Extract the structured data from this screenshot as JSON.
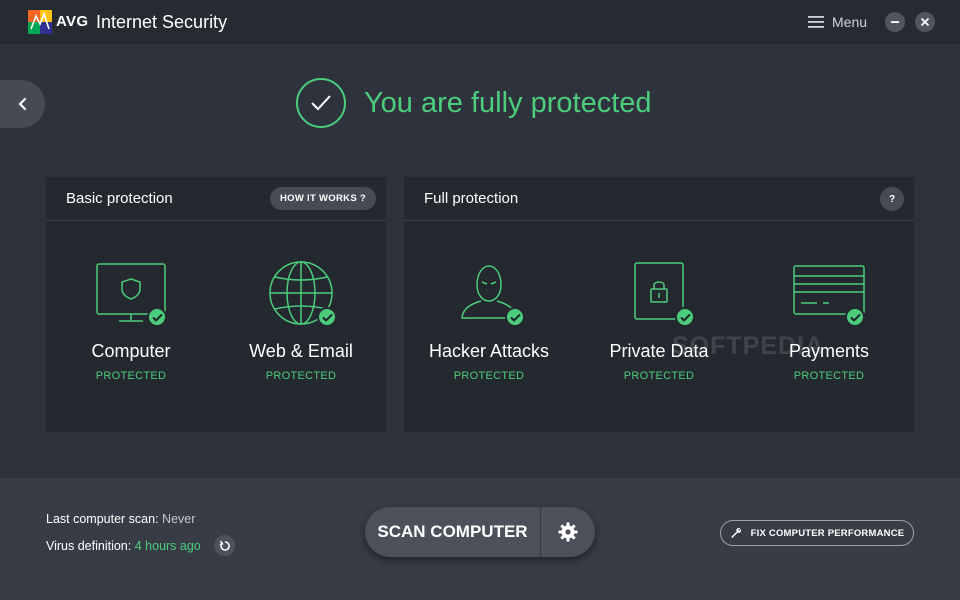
{
  "titlebar": {
    "brand": "AVG",
    "product": "Internet Security",
    "menu_label": "Menu"
  },
  "hero": {
    "status_text": "You are fully protected"
  },
  "basic_panel": {
    "title": "Basic protection",
    "help_button": "HOW IT WORKS ?",
    "features": [
      {
        "name": "Computer",
        "status": "PROTECTED",
        "icon": "monitor-shield-icon"
      },
      {
        "name": "Web & Email",
        "status": "PROTECTED",
        "icon": "globe-icon"
      }
    ]
  },
  "full_panel": {
    "title": "Full protection",
    "help_button": "?",
    "features": [
      {
        "name": "Hacker Attacks",
        "status": "PROTECTED",
        "icon": "hacker-icon"
      },
      {
        "name": "Private Data",
        "status": "PROTECTED",
        "icon": "lock-document-icon"
      },
      {
        "name": "Payments",
        "status": "PROTECTED",
        "icon": "credit-card-icon"
      }
    ]
  },
  "watermark": "SOFTPEDIA",
  "footer": {
    "last_scan_label": "Last computer scan:",
    "last_scan_value": "Never",
    "virus_def_label": "Virus definition:",
    "virus_def_value": "4 hours ago",
    "scan_button": "SCAN COMPUTER",
    "fix_button": "FIX COMPUTER PERFORMANCE"
  },
  "colors": {
    "accent_green": "#4ccd7c",
    "background": "#2e323c",
    "panel": "#24282f",
    "titlebar": "#262a31",
    "footer": "#383c46"
  }
}
